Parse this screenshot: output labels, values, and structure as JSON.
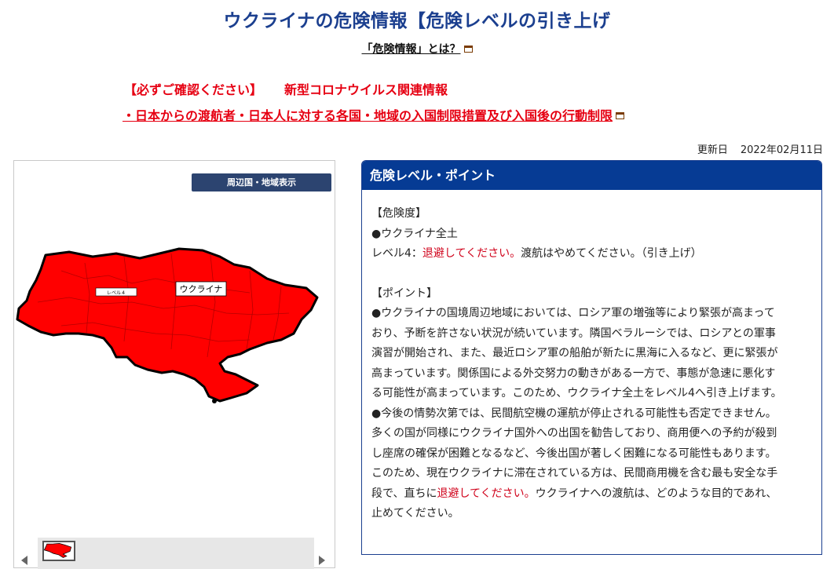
{
  "page": {
    "title": "ウクライナの危険情報【危険レベルの引き上げ",
    "about_link": "「危険情報」とは？"
  },
  "notice": {
    "label": "【必ずご確認ください】",
    "covid": "新型コロナウイルス関連情報",
    "link": "・日本からの渡航者・日本人に対する各国・地域の入国制限措置及び入国後の行動制限"
  },
  "updated": {
    "label": "更新日",
    "date": "2022年02月11日"
  },
  "map": {
    "region_button": "周辺国・地域表示",
    "country_label": "ウクライナ",
    "fill_color": "#ff0000",
    "legend_label": "レベル４"
  },
  "info": {
    "header": "危険レベル・ポイント",
    "risk_heading": "【危険度】",
    "risk_area": "●ウクライナ全土",
    "risk_level_prefix": "レベル4：",
    "risk_level_red": "退避してください。",
    "risk_level_suffix": "渡航はやめてください。（引き上げ）",
    "point_heading": "【ポイント】",
    "point1_l1": "●ウクライナの国境周辺地域においては、ロシア軍の増強等により緊張が高まって",
    "point1_l2": "おり、予断を許さない状況が続いています。隣国ベラルーシでは、ロシアとの軍事",
    "point1_l3": "演習が開始され、また、最近ロシア軍の船舶が新たに黒海に入るなど、更に緊張が",
    "point1_l4": "高まっています。関係国による外交努力の動きがある一方で、事態が急速に悪化す",
    "point1_l5": "る可能性が高まっています。このため、ウクライナ全土をレベル4へ引き上げます。",
    "point2_l1": "●今後の情勢次第では、民間航空機の運航が停止される可能性も否定できません。",
    "point2_l2": "多くの国が同様にウクライナ国外への出国を勧告しており、商用便への予約が殺到",
    "point2_l3": "し座席の確保が困難となるなど、今後出国が著しく困難になる可能性もあります。",
    "point2_l4": "このため、現在ウクライナに滞在されている方は、民間商用機を含む最も安全な手",
    "point2_l5_prefix": "段で、直ちに",
    "point2_l5_red": "退避してください。",
    "point2_l5_suffix": "ウクライナへの渡航は、どのような目的であれ、",
    "point2_l6": "止めてください。"
  },
  "colors": {
    "title": "#1b3f8f",
    "notice": "#e60012",
    "header_bg": "#063b94",
    "region_button_bg": "#2c4470"
  }
}
